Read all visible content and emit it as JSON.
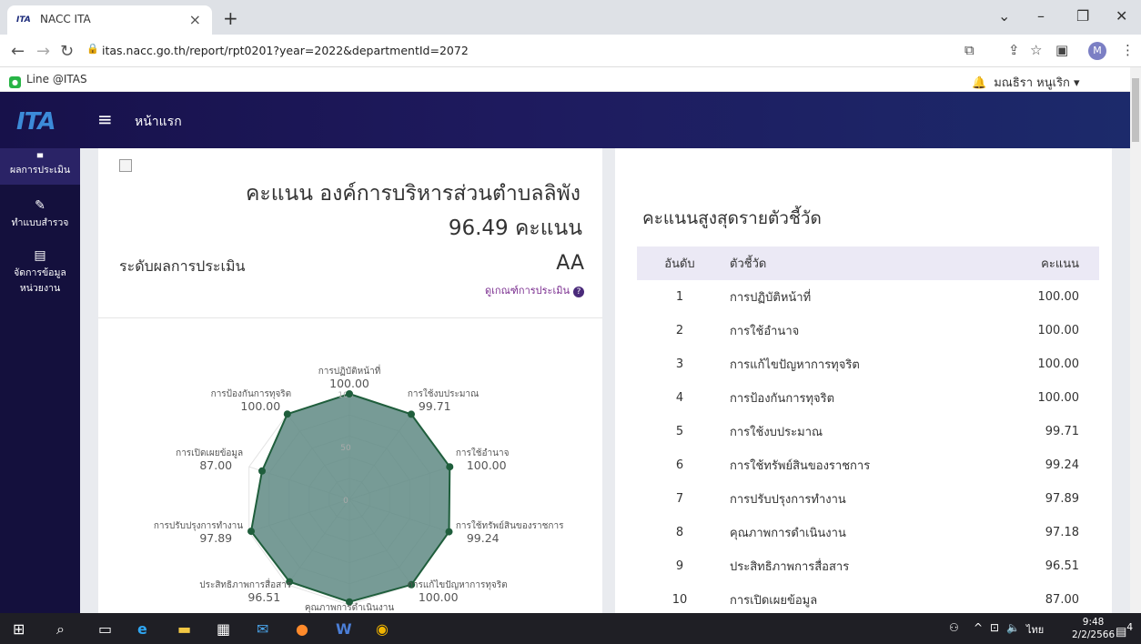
{
  "browser": {
    "tab_title": "NACC ITA",
    "tab_favicon": "ITA",
    "new_tab": "+",
    "url": "itas.nacc.go.th/report/rpt0201?year=2022&departmentId=2072",
    "profile_initial": "M",
    "bookmark": "Line @ITAS",
    "user_name": "มณธิรา หนูเริก"
  },
  "app": {
    "logo": "ITA",
    "home_label": "หน้าแรก"
  },
  "sidebar": {
    "items": [
      {
        "label": "ผลการประเมิน",
        "icon": "chart-icon"
      },
      {
        "label": "ทำแบบสำรวจ",
        "icon": "edit-icon"
      },
      {
        "label": "จัดการข้อมูล",
        "label2": "หน่วยงาน",
        "icon": "document-icon"
      }
    ]
  },
  "score_card": {
    "org_title": "คะแนน องค์การบริหารส่วนตำบลลิพัง",
    "score_text": "96.49 คะแนน",
    "level_label": "ระดับผลการประเมิน",
    "level_value": "AA",
    "criteria_link": "ดูเกณฑ์การประเมิน"
  },
  "chart_data": {
    "type": "radar",
    "scale_min": 0,
    "scale_max": 100,
    "scale_ticks": [
      0,
      50,
      100
    ],
    "fill_color": "#5f8a84",
    "stroke_color": "#1f5e3c",
    "axes": [
      {
        "label": "การปฏิบัติหน้าที่",
        "value": "100.00"
      },
      {
        "label": "การใช้งบประมาณ",
        "value": "99.71"
      },
      {
        "label": "การใช้อำนาจ",
        "value": "100.00"
      },
      {
        "label": "การใช้ทรัพย์สินของราชการ",
        "value": "99.24"
      },
      {
        "label": "การแก้ไขปัญหาการทุจริต",
        "value": "100.00"
      },
      {
        "label": "คุณภาพการดำเนินงาน",
        "value": "97.18"
      },
      {
        "label": "ประสิทธิภาพการสื่อสาร",
        "value": "96.51"
      },
      {
        "label": "การปรับปรุงการทำงาน",
        "value": "97.89"
      },
      {
        "label": "การเปิดเผยข้อมูล",
        "value": "87.00"
      },
      {
        "label": "การป้องกันการทุจริต",
        "value": "100.00"
      }
    ]
  },
  "ranking": {
    "title": "คะแนนสูงสุดรายตัวชี้วัด",
    "headers": [
      "อันดับ",
      "ตัวชี้วัด",
      "คะแนน"
    ],
    "rows": [
      [
        "1",
        "การปฏิบัติหน้าที่",
        "100.00"
      ],
      [
        "2",
        "การใช้อำนาจ",
        "100.00"
      ],
      [
        "3",
        "การแก้ไขปัญหาการทุจริต",
        "100.00"
      ],
      [
        "4",
        "การป้องกันการทุจริต",
        "100.00"
      ],
      [
        "5",
        "การใช้งบประมาณ",
        "99.71"
      ],
      [
        "6",
        "การใช้ทรัพย์สินของราชการ",
        "99.24"
      ],
      [
        "7",
        "การปรับปรุงการทำงาน",
        "97.89"
      ],
      [
        "8",
        "คุณภาพการดำเนินงาน",
        "97.18"
      ],
      [
        "9",
        "ประสิทธิภาพการสื่อสาร",
        "96.51"
      ],
      [
        "10",
        "การเปิดเผยข้อมูล",
        "87.00"
      ]
    ]
  },
  "taskbar": {
    "time": "9:48",
    "date": "2/2/2566",
    "lang": "ไทย",
    "notification_count": "4"
  }
}
